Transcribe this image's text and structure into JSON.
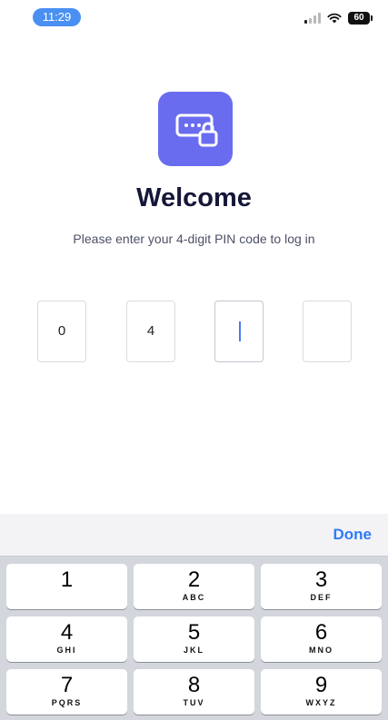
{
  "status_bar": {
    "time": "11:29",
    "battery": "60"
  },
  "login": {
    "icon": "password-lock-icon",
    "title": "Welcome",
    "subtitle": "Please enter your 4-digit PIN code to log in"
  },
  "pin": {
    "digits": [
      "0",
      "4",
      "",
      ""
    ],
    "focused_index": 2
  },
  "keyboard": {
    "done_label": "Done",
    "keys": [
      {
        "digit": "1",
        "letters": ""
      },
      {
        "digit": "2",
        "letters": "ABC"
      },
      {
        "digit": "3",
        "letters": "DEF"
      },
      {
        "digit": "4",
        "letters": "GHI"
      },
      {
        "digit": "5",
        "letters": "JKL"
      },
      {
        "digit": "6",
        "letters": "MNO"
      },
      {
        "digit": "7",
        "letters": "PQRS"
      },
      {
        "digit": "8",
        "letters": "TUV"
      },
      {
        "digit": "9",
        "letters": "WXYZ"
      }
    ]
  },
  "colors": {
    "accent": "#6a6cf0",
    "link": "#2f7bf6",
    "caret": "#4a7cf0",
    "time_pill": "#4a90f2"
  }
}
